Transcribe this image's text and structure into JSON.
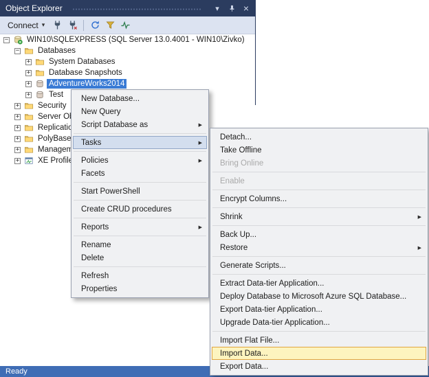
{
  "object_explorer": {
    "title": "Object Explorer",
    "toolbar": {
      "connect_label": "Connect"
    },
    "tree": {
      "items": [
        {
          "label": "WIN10\\SQLEXPRESS (SQL Server 13.0.4001 - WIN10\\Zivko)",
          "level": 0,
          "expander": "expanded",
          "icon": "server"
        },
        {
          "label": "Databases",
          "level": 1,
          "expander": "expanded",
          "icon": "folder"
        },
        {
          "label": "System Databases",
          "level": 2,
          "expander": "collapsed",
          "icon": "folder"
        },
        {
          "label": "Database Snapshots",
          "level": 2,
          "expander": "collapsed",
          "icon": "folder"
        },
        {
          "label": "AdventureWorks2014",
          "level": 2,
          "expander": "collapsed",
          "icon": "database",
          "selected": true
        },
        {
          "label": "Test",
          "level": 2,
          "expander": "collapsed",
          "icon": "database"
        },
        {
          "label": "Security",
          "level": 1,
          "expander": "collapsed",
          "icon": "folder"
        },
        {
          "label": "Server Objects",
          "level": 1,
          "expander": "collapsed",
          "icon": "folder"
        },
        {
          "label": "Replication",
          "level": 1,
          "expander": "collapsed",
          "icon": "folder"
        },
        {
          "label": "PolyBase",
          "level": 1,
          "expander": "collapsed",
          "icon": "folder"
        },
        {
          "label": "Management",
          "level": 1,
          "expander": "collapsed",
          "icon": "folder"
        },
        {
          "label": "XE Profiler",
          "level": 1,
          "expander": "collapsed",
          "icon": "xe"
        }
      ]
    }
  },
  "context_menu": {
    "items": [
      {
        "label": "New Database..."
      },
      {
        "label": "New Query"
      },
      {
        "label": "Script Database as",
        "submenu": true
      },
      {
        "type": "separator"
      },
      {
        "label": "Tasks",
        "submenu": true,
        "state": "open"
      },
      {
        "type": "separator"
      },
      {
        "label": "Policies",
        "submenu": true
      },
      {
        "label": "Facets"
      },
      {
        "type": "separator"
      },
      {
        "label": "Start PowerShell"
      },
      {
        "type": "separator"
      },
      {
        "label": "Create CRUD procedures"
      },
      {
        "type": "separator"
      },
      {
        "label": "Reports",
        "submenu": true
      },
      {
        "type": "separator"
      },
      {
        "label": "Rename"
      },
      {
        "label": "Delete"
      },
      {
        "type": "separator"
      },
      {
        "label": "Refresh"
      },
      {
        "label": "Properties"
      }
    ]
  },
  "tasks_submenu": {
    "items": [
      {
        "label": "Detach..."
      },
      {
        "label": "Take Offline"
      },
      {
        "label": "Bring Online",
        "state": "disabled"
      },
      {
        "type": "separator"
      },
      {
        "label": "Enable",
        "state": "disabled"
      },
      {
        "type": "separator"
      },
      {
        "label": "Encrypt Columns..."
      },
      {
        "type": "separator"
      },
      {
        "label": "Shrink",
        "submenu": true
      },
      {
        "type": "separator"
      },
      {
        "label": "Back Up..."
      },
      {
        "label": "Restore",
        "submenu": true
      },
      {
        "type": "separator"
      },
      {
        "label": "Generate Scripts..."
      },
      {
        "type": "separator"
      },
      {
        "label": "Extract Data-tier Application..."
      },
      {
        "label": "Deploy Database to Microsoft Azure SQL Database..."
      },
      {
        "label": "Export Data-tier Application..."
      },
      {
        "label": "Upgrade Data-tier Application..."
      },
      {
        "type": "separator"
      },
      {
        "label": "Import Flat File..."
      },
      {
        "label": "Import Data...",
        "state": "hover"
      },
      {
        "label": "Export Data..."
      }
    ]
  },
  "status_bar": {
    "text": "Ready"
  },
  "icons": {
    "window_position_glyph": "▾",
    "close_glyph": "×",
    "connect_caret_glyph": "▾",
    "submenu_arrow_glyph": "▶",
    "expand_glyph": "+",
    "collapse_glyph": "−",
    "toolbar": [
      "connect-plug",
      "disconnect-plug",
      "refresh",
      "filter",
      "activity"
    ]
  },
  "colors": {
    "titlebar": "#2b3c5f",
    "statusbar": "#3f6db5",
    "tree_selection": "#3a7bd5",
    "open_submenu_highlight": "#d3deee",
    "open_submenu_border": "#91a6c6",
    "hovered_item_highlight": "#fdf4bf",
    "hovered_item_border": "#e0a53f"
  }
}
